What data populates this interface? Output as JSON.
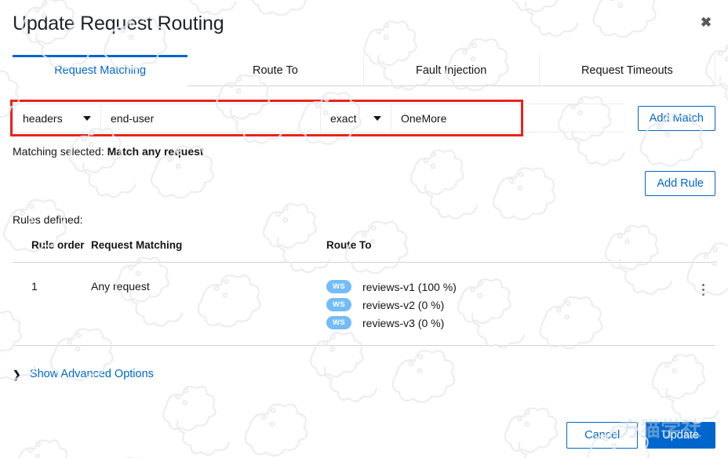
{
  "dialog": {
    "title": "Update Request Routing",
    "close_icon": "close-icon"
  },
  "tabs": [
    {
      "label": "Request Matching",
      "active": true
    },
    {
      "label": "Route To",
      "active": false
    },
    {
      "label": "Fault Injection",
      "active": false
    },
    {
      "label": "Request Timeouts",
      "active": false
    }
  ],
  "match_row": {
    "category": "headers",
    "header_name": "end-user",
    "operator": "exact",
    "value": "OneMore",
    "add_match_label": "Add Match",
    "highlight_color": "#e8241a"
  },
  "matching_selected": {
    "prefix": "Matching selected:",
    "value": "Match any request"
  },
  "add_rule_label": "Add Rule",
  "rules_label": "Rules defined:",
  "table": {
    "headers": [
      "Rule order",
      "Request Matching",
      "Route To"
    ],
    "rows": [
      {
        "order": "1",
        "request_matching": "Any request",
        "routes": [
          {
            "badge": "WS",
            "name": "reviews-v1 (100 %)"
          },
          {
            "badge": "WS",
            "name": "reviews-v2 (0 %)"
          },
          {
            "badge": "WS",
            "name": "reviews-v3 (0 %)"
          }
        ]
      }
    ]
  },
  "advanced": {
    "chevron": "❯",
    "label": "Show Advanced Options"
  },
  "footer": {
    "cancel_label": "Cancel",
    "update_label": "Update"
  },
  "colors": {
    "accent": "#06c",
    "badge": "#73bcf7",
    "annotation": "#e8241a"
  }
}
